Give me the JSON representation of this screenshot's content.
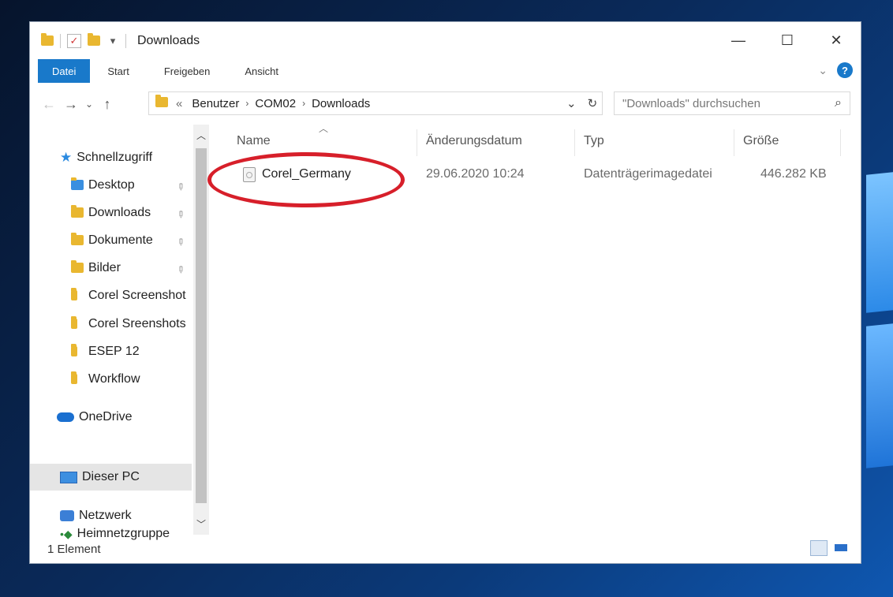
{
  "window": {
    "title": "Downloads"
  },
  "caption": {
    "minimize": "—",
    "maximize": "☐",
    "close": "✕"
  },
  "ribbon": {
    "tabs": [
      "Datei",
      "Start",
      "Freigeben",
      "Ansicht"
    ]
  },
  "address": {
    "overflow": "«",
    "segments": [
      "Benutzer",
      "COM02",
      "Downloads"
    ],
    "search_placeholder": "\"Downloads\" durchsuchen"
  },
  "nav": {
    "quick_access": "Schnellzugriff",
    "items": [
      "Desktop",
      "Downloads",
      "Dokumente",
      "Bilder",
      "Corel Screenshot",
      "Corel Sreenshots",
      "ESEP 12",
      "Workflow"
    ],
    "onedrive": "OneDrive",
    "this_pc": "Dieser PC",
    "network": "Netzwerk",
    "homegroup": "Heimnetzgruppe"
  },
  "columns": {
    "name": "Name",
    "date": "Änderungsdatum",
    "type": "Typ",
    "size": "Größe"
  },
  "files": [
    {
      "name": "Corel_Germany",
      "date": "29.06.2020 10:24",
      "type": "Datenträgerimagedatei",
      "size": "446.282 KB"
    }
  ],
  "status": {
    "count": "1 Element"
  },
  "colors": {
    "accent": "#1979ca",
    "highlight_ellipse": "#d71f2a"
  }
}
